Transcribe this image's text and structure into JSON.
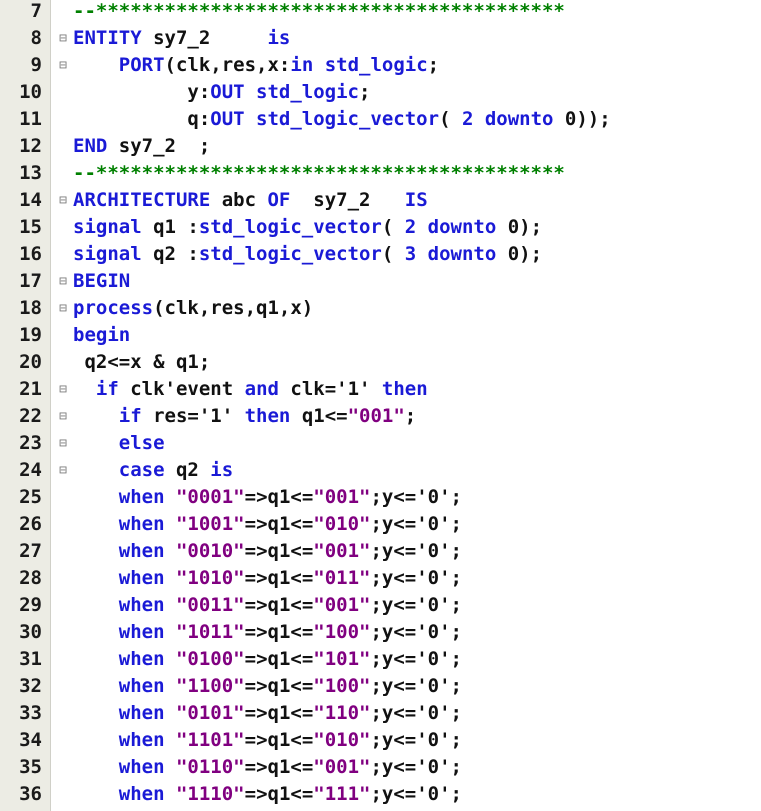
{
  "editor": {
    "language": "VHDL",
    "colors": {
      "keyword": "#1a1ad6",
      "string": "#800080",
      "comment": "#008000",
      "text": "#111111",
      "gutter": "#ecece4"
    },
    "fold_marker": "⊟",
    "lines": [
      {
        "n": "7",
        "fold": false,
        "tokens": [
          {
            "t": "cmt",
            "v": "--*****************************************"
          }
        ]
      },
      {
        "n": "8",
        "fold": true,
        "tokens": [
          {
            "t": "kw",
            "v": "ENTITY"
          },
          {
            "t": "id",
            "v": " sy7_2     "
          },
          {
            "t": "kw",
            "v": "is"
          }
        ]
      },
      {
        "n": "9",
        "fold": true,
        "tokens": [
          {
            "t": "id",
            "v": "    "
          },
          {
            "t": "kw",
            "v": "PORT"
          },
          {
            "t": "op",
            "v": "(clk,res,x:"
          },
          {
            "t": "kw",
            "v": "in std_logic"
          },
          {
            "t": "op",
            "v": ";"
          }
        ]
      },
      {
        "n": "10",
        "fold": false,
        "tokens": [
          {
            "t": "id",
            "v": "          y:"
          },
          {
            "t": "kw",
            "v": "OUT std_logic"
          },
          {
            "t": "op",
            "v": ";"
          }
        ]
      },
      {
        "n": "11",
        "fold": false,
        "tokens": [
          {
            "t": "id",
            "v": "          q:"
          },
          {
            "t": "kw",
            "v": "OUT std_logic_vector"
          },
          {
            "t": "op",
            "v": "( "
          },
          {
            "t": "kw",
            "v": "2 downto"
          },
          {
            "t": "op",
            "v": " 0));"
          }
        ]
      },
      {
        "n": "12",
        "fold": false,
        "tokens": [
          {
            "t": "kw",
            "v": "END"
          },
          {
            "t": "id",
            "v": " sy7_2  ;"
          }
        ]
      },
      {
        "n": "13",
        "fold": false,
        "tokens": [
          {
            "t": "cmt",
            "v": "--*****************************************"
          }
        ]
      },
      {
        "n": "14",
        "fold": true,
        "tokens": [
          {
            "t": "kw",
            "v": "ARCHITECTURE"
          },
          {
            "t": "id",
            "v": " abc "
          },
          {
            "t": "kw",
            "v": "OF"
          },
          {
            "t": "id",
            "v": "  sy7_2   "
          },
          {
            "t": "kw",
            "v": "IS"
          }
        ]
      },
      {
        "n": "15",
        "fold": false,
        "tokens": [
          {
            "t": "kw",
            "v": "signal"
          },
          {
            "t": "id",
            "v": " q1 :"
          },
          {
            "t": "kw",
            "v": "std_logic_vector"
          },
          {
            "t": "op",
            "v": "( "
          },
          {
            "t": "kw",
            "v": "2 downto"
          },
          {
            "t": "op",
            "v": " 0);"
          }
        ]
      },
      {
        "n": "16",
        "fold": false,
        "tokens": [
          {
            "t": "kw",
            "v": "signal"
          },
          {
            "t": "id",
            "v": " q2 :"
          },
          {
            "t": "kw",
            "v": "std_logic_vector"
          },
          {
            "t": "op",
            "v": "( "
          },
          {
            "t": "kw",
            "v": "3 downto"
          },
          {
            "t": "op",
            "v": " 0);"
          }
        ]
      },
      {
        "n": "17",
        "fold": true,
        "tokens": [
          {
            "t": "kw",
            "v": "BEGIN"
          }
        ]
      },
      {
        "n": "18",
        "fold": true,
        "tokens": [
          {
            "t": "kw",
            "v": "process"
          },
          {
            "t": "op",
            "v": "(clk,res,q1,x)"
          }
        ]
      },
      {
        "n": "19",
        "fold": false,
        "tokens": [
          {
            "t": "kw",
            "v": "begin"
          }
        ]
      },
      {
        "n": "20",
        "fold": false,
        "tokens": [
          {
            "t": "id",
            "v": " q2<=x & q1;"
          }
        ]
      },
      {
        "n": "21",
        "fold": true,
        "tokens": [
          {
            "t": "id",
            "v": "  "
          },
          {
            "t": "kw",
            "v": "if"
          },
          {
            "t": "id",
            "v": " clk'event "
          },
          {
            "t": "kw",
            "v": "and"
          },
          {
            "t": "id",
            "v": " clk='1' "
          },
          {
            "t": "kw",
            "v": "then"
          }
        ]
      },
      {
        "n": "22",
        "fold": true,
        "tokens": [
          {
            "t": "id",
            "v": "    "
          },
          {
            "t": "kw",
            "v": "if"
          },
          {
            "t": "id",
            "v": " res='1' "
          },
          {
            "t": "kw",
            "v": "then"
          },
          {
            "t": "id",
            "v": " q1<="
          },
          {
            "t": "str",
            "v": "\"001\""
          },
          {
            "t": "op",
            "v": ";"
          }
        ]
      },
      {
        "n": "23",
        "fold": true,
        "tokens": [
          {
            "t": "id",
            "v": "    "
          },
          {
            "t": "kw",
            "v": "else"
          }
        ]
      },
      {
        "n": "24",
        "fold": true,
        "tokens": [
          {
            "t": "id",
            "v": "    "
          },
          {
            "t": "kw",
            "v": "case"
          },
          {
            "t": "id",
            "v": " q2 "
          },
          {
            "t": "kw",
            "v": "is"
          }
        ]
      },
      {
        "n": "25",
        "fold": false,
        "tokens": [
          {
            "t": "id",
            "v": "    "
          },
          {
            "t": "kw",
            "v": "when"
          },
          {
            "t": "id",
            "v": " "
          },
          {
            "t": "str",
            "v": "\"0001\""
          },
          {
            "t": "op",
            "v": "=>q1<="
          },
          {
            "t": "str",
            "v": "\"001\""
          },
          {
            "t": "op",
            "v": ";y<='0';"
          }
        ]
      },
      {
        "n": "26",
        "fold": false,
        "tokens": [
          {
            "t": "id",
            "v": "    "
          },
          {
            "t": "kw",
            "v": "when"
          },
          {
            "t": "id",
            "v": " "
          },
          {
            "t": "str",
            "v": "\"1001\""
          },
          {
            "t": "op",
            "v": "=>q1<="
          },
          {
            "t": "str",
            "v": "\"010\""
          },
          {
            "t": "op",
            "v": ";y<='0';"
          }
        ]
      },
      {
        "n": "27",
        "fold": false,
        "tokens": [
          {
            "t": "id",
            "v": "    "
          },
          {
            "t": "kw",
            "v": "when"
          },
          {
            "t": "id",
            "v": " "
          },
          {
            "t": "str",
            "v": "\"0010\""
          },
          {
            "t": "op",
            "v": "=>q1<="
          },
          {
            "t": "str",
            "v": "\"001\""
          },
          {
            "t": "op",
            "v": ";y<='0';"
          }
        ]
      },
      {
        "n": "28",
        "fold": false,
        "tokens": [
          {
            "t": "id",
            "v": "    "
          },
          {
            "t": "kw",
            "v": "when"
          },
          {
            "t": "id",
            "v": " "
          },
          {
            "t": "str",
            "v": "\"1010\""
          },
          {
            "t": "op",
            "v": "=>q1<="
          },
          {
            "t": "str",
            "v": "\"011\""
          },
          {
            "t": "op",
            "v": ";y<='0';"
          }
        ]
      },
      {
        "n": "29",
        "fold": false,
        "tokens": [
          {
            "t": "id",
            "v": "    "
          },
          {
            "t": "kw",
            "v": "when"
          },
          {
            "t": "id",
            "v": " "
          },
          {
            "t": "str",
            "v": "\"0011\""
          },
          {
            "t": "op",
            "v": "=>q1<="
          },
          {
            "t": "str",
            "v": "\"001\""
          },
          {
            "t": "op",
            "v": ";y<='0';"
          }
        ]
      },
      {
        "n": "30",
        "fold": false,
        "tokens": [
          {
            "t": "id",
            "v": "    "
          },
          {
            "t": "kw",
            "v": "when"
          },
          {
            "t": "id",
            "v": " "
          },
          {
            "t": "str",
            "v": "\"1011\""
          },
          {
            "t": "op",
            "v": "=>q1<="
          },
          {
            "t": "str",
            "v": "\"100\""
          },
          {
            "t": "op",
            "v": ";y<='0';"
          }
        ]
      },
      {
        "n": "31",
        "fold": false,
        "tokens": [
          {
            "t": "id",
            "v": "    "
          },
          {
            "t": "kw",
            "v": "when"
          },
          {
            "t": "id",
            "v": " "
          },
          {
            "t": "str",
            "v": "\"0100\""
          },
          {
            "t": "op",
            "v": "=>q1<="
          },
          {
            "t": "str",
            "v": "\"101\""
          },
          {
            "t": "op",
            "v": ";y<='0';"
          }
        ]
      },
      {
        "n": "32",
        "fold": false,
        "tokens": [
          {
            "t": "id",
            "v": "    "
          },
          {
            "t": "kw",
            "v": "when"
          },
          {
            "t": "id",
            "v": " "
          },
          {
            "t": "str",
            "v": "\"1100\""
          },
          {
            "t": "op",
            "v": "=>q1<="
          },
          {
            "t": "str",
            "v": "\"100\""
          },
          {
            "t": "op",
            "v": ";y<='0';"
          }
        ]
      },
      {
        "n": "33",
        "fold": false,
        "tokens": [
          {
            "t": "id",
            "v": "    "
          },
          {
            "t": "kw",
            "v": "when"
          },
          {
            "t": "id",
            "v": " "
          },
          {
            "t": "str",
            "v": "\"0101\""
          },
          {
            "t": "op",
            "v": "=>q1<="
          },
          {
            "t": "str",
            "v": "\"110\""
          },
          {
            "t": "op",
            "v": ";y<='0';"
          }
        ]
      },
      {
        "n": "34",
        "fold": false,
        "tokens": [
          {
            "t": "id",
            "v": "    "
          },
          {
            "t": "kw",
            "v": "when"
          },
          {
            "t": "id",
            "v": " "
          },
          {
            "t": "str",
            "v": "\"1101\""
          },
          {
            "t": "op",
            "v": "=>q1<="
          },
          {
            "t": "str",
            "v": "\"010\""
          },
          {
            "t": "op",
            "v": ";y<='0';"
          }
        ]
      },
      {
        "n": "35",
        "fold": false,
        "tokens": [
          {
            "t": "id",
            "v": "    "
          },
          {
            "t": "kw",
            "v": "when"
          },
          {
            "t": "id",
            "v": " "
          },
          {
            "t": "str",
            "v": "\"0110\""
          },
          {
            "t": "op",
            "v": "=>q1<="
          },
          {
            "t": "str",
            "v": "\"001\""
          },
          {
            "t": "op",
            "v": ";y<='0';"
          }
        ]
      },
      {
        "n": "36",
        "fold": false,
        "tokens": [
          {
            "t": "id",
            "v": "    "
          },
          {
            "t": "kw",
            "v": "when"
          },
          {
            "t": "id",
            "v": " "
          },
          {
            "t": "str",
            "v": "\"1110\""
          },
          {
            "t": "op",
            "v": "=>q1<="
          },
          {
            "t": "str",
            "v": "\"111\""
          },
          {
            "t": "op",
            "v": ";y<='0';"
          }
        ]
      }
    ]
  }
}
